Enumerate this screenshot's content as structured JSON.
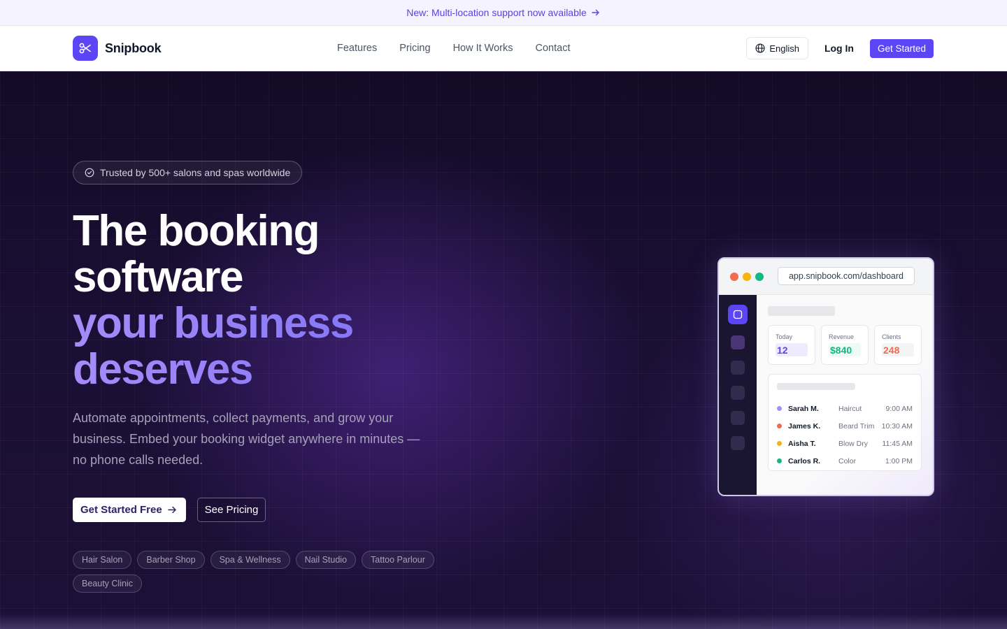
{
  "announcement": {
    "text": "New: Multi-location support now available",
    "arrow_icon": "arrow-right-icon"
  },
  "nav": {
    "brand": "Snipbook",
    "links": [
      "Features",
      "Pricing",
      "How It Works",
      "Contact"
    ],
    "language": "English",
    "login": "Log In",
    "cta": "Get Started"
  },
  "hero": {
    "trust_badge": "Trusted by 500+ salons and spas worldwide",
    "headline": {
      "line1": "The booking",
      "line2": "software",
      "line3": "your business",
      "line4": "deserves"
    },
    "subtitle": "Automate appointments, collect payments, and grow your business. Embed your booking widget anywhere in minutes — no phone calls needed.",
    "primary_cta": "Get Started Free",
    "secondary_cta": "See Pricing",
    "tags": [
      "Hair Salon",
      "Barber Shop",
      "Spa & Wellness",
      "Nail Studio",
      "Tattoo Parlour",
      "Beauty Clinic"
    ]
  },
  "dashboard": {
    "url": "app.snipbook.com/dashboard",
    "stats": [
      {
        "label": "Today",
        "value": "12",
        "color": "#5b45f5",
        "bg": "#eeebff"
      },
      {
        "label": "Revenue",
        "value": "$840",
        "color": "#10b981",
        "bg": "#eefaf4"
      },
      {
        "label": "Clients",
        "value": "248",
        "color": "#f26a4f",
        "bg": "#f3f4f6"
      }
    ],
    "appointments": [
      {
        "name": "Sarah M.",
        "service": "Haircut",
        "time": "9:00 AM",
        "color": "#a78bfa"
      },
      {
        "name": "James K.",
        "service": "Beard Trim",
        "time": "10:30 AM",
        "color": "#f26a4f"
      },
      {
        "name": "Aisha T.",
        "service": "Blow Dry",
        "time": "11:45 AM",
        "color": "#f5b50a"
      },
      {
        "name": "Carlos R.",
        "service": "Color",
        "time": "1:00 PM",
        "color": "#10b981"
      }
    ]
  },
  "colors": {
    "accent": "#5b45f5",
    "gradient_text": "#a78bfa"
  }
}
